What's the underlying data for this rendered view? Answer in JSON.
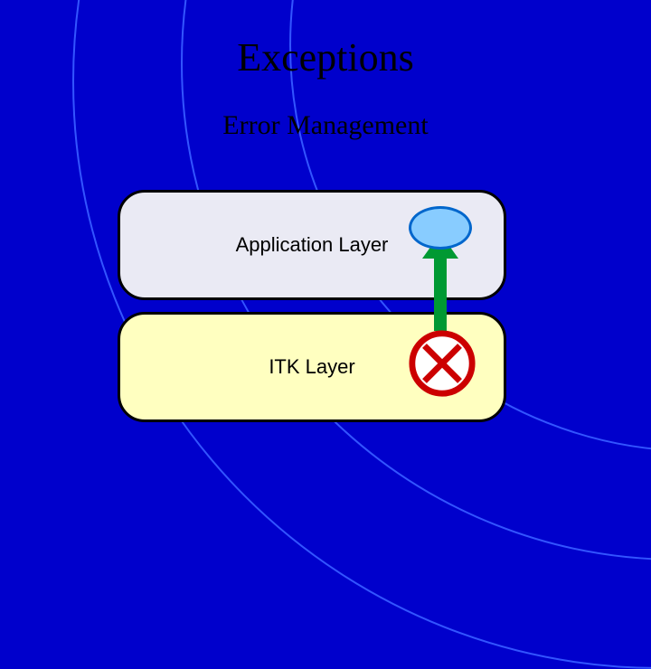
{
  "slide": {
    "title": "Exceptions",
    "subtitle": "Error Management",
    "layers": {
      "application": "Application Layer",
      "itk": "ITK Layer"
    }
  },
  "colors": {
    "background": "#0000CC",
    "arc_stroke": "#3355FF",
    "app_layer_bg": "#EAEAF4",
    "itk_layer_bg": "#FFFFC0",
    "bubble_fill": "#88CCFF",
    "bubble_stroke": "#0066CC",
    "arrow": "#009933",
    "error_stroke": "#CC0000"
  }
}
